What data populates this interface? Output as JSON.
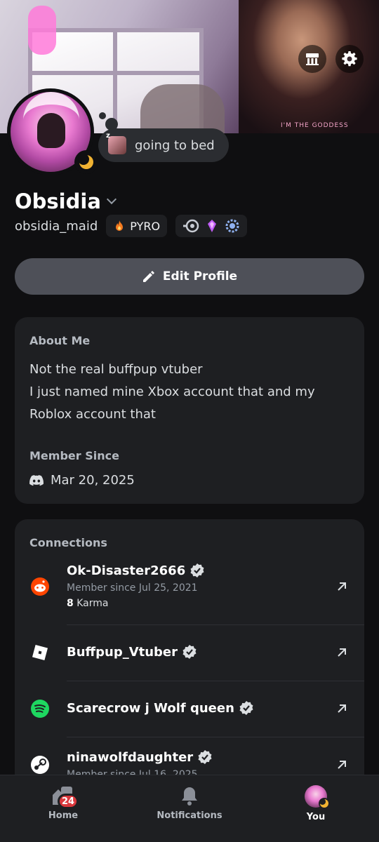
{
  "colors": {
    "accent": "#5865f2",
    "background": "#0f0f11",
    "card": "#1e1f22",
    "badge_red": "#da373c",
    "status_idle": "#f0b232"
  },
  "banner": {
    "shirt_text": "I'M THE GODDESS",
    "shop_icon": "shop-icon",
    "settings_icon": "gear-icon"
  },
  "status": {
    "text": "going to bed"
  },
  "profile": {
    "display_name": "Obsidia",
    "username": "obsidia_maid",
    "tag": "PYRO",
    "edit_label": "Edit Profile"
  },
  "about": {
    "title": "About Me",
    "lines": [
      "Not the real buffpup vtuber",
      "I just named mine Xbox account that and  my",
      "Roblox account that"
    ],
    "member_since_title": "Member Since",
    "member_since_date": "Mar 20, 2025"
  },
  "connections": {
    "title": "Connections",
    "items": [
      {
        "service": "reddit",
        "name": "Ok-Disaster2666",
        "sub": "Member since Jul 25, 2021",
        "karma_value": "8",
        "karma_label": "Karma"
      },
      {
        "service": "roblox",
        "name": "Buffpup_Vtuber"
      },
      {
        "service": "spotify",
        "name": "Scarecrow j Wolf queen"
      },
      {
        "service": "steam",
        "name": "ninawolfdaughter",
        "sub": "Member since Jul 16, 2025"
      }
    ]
  },
  "nav": {
    "home": "Home",
    "home_badge": "24",
    "notifications": "Notifications",
    "you": "You"
  }
}
